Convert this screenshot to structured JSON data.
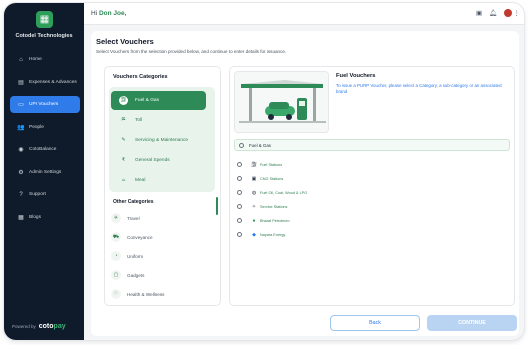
{
  "brand": {
    "name": "Cotodel Technologies",
    "logo_icon": "building-icon"
  },
  "sidebar": {
    "items": [
      {
        "label": "Home",
        "icon": "home-icon",
        "active": false
      },
      {
        "label": "Expenses & Advances",
        "icon": "receipt-icon",
        "active": false
      },
      {
        "label": "UPI Vouchers",
        "icon": "voucher-icon",
        "active": true
      },
      {
        "label": "People",
        "icon": "people-icon",
        "active": false
      },
      {
        "label": "CotoBalance",
        "icon": "wallet-icon",
        "active": false
      },
      {
        "label": "Admin Settings",
        "icon": "gear-icon",
        "active": false
      },
      {
        "label": "Support",
        "icon": "support-icon",
        "active": false
      },
      {
        "label": "Blogs",
        "icon": "blog-icon",
        "active": false
      }
    ],
    "powered_by": "Powered by",
    "powered_brand_a": "coto",
    "powered_brand_b": "pay"
  },
  "header": {
    "greeting": "Hi",
    "user_name": "Don Joe,"
  },
  "main": {
    "title": "Select Vouchers",
    "subtitle": "Select Vouchers from the selection provided below, and continue to enter details for issuance.",
    "categories_heading": "Vouchers Categories",
    "categories": [
      {
        "label": "Fuel & Gas",
        "icon": "fuel-icon",
        "active": true
      },
      {
        "label": "Toll",
        "icon": "toll-icon",
        "active": false
      },
      {
        "label": "Servicing & Maintenance",
        "icon": "wrench-icon",
        "active": false
      },
      {
        "label": "General Spends",
        "icon": "rupee-icon",
        "active": false
      },
      {
        "label": "Meal",
        "icon": "meal-icon",
        "active": false
      }
    ],
    "other_heading": "Other Categories",
    "other_categories": [
      {
        "label": "Travel",
        "icon": "travel-icon"
      },
      {
        "label": "Conveyance",
        "icon": "car-icon"
      },
      {
        "label": "Uniform",
        "icon": "shirt-icon"
      },
      {
        "label": "Gadgets",
        "icon": "gadget-icon"
      },
      {
        "label": "Health & Wellness",
        "icon": "heart-icon"
      }
    ],
    "fuel_title": "Fuel Vouchers",
    "fuel_description": "To issue a PURP Voucher, please select a Category, a sub-category or an associated brand",
    "selected_category": "Fuel & Gas",
    "sub_categories": [
      {
        "label": "Fuel Stations",
        "icon": "pump-icon"
      },
      {
        "label": "CNG Stations",
        "icon": "cng-icon"
      },
      {
        "label": "Fuel Oil, Coal, Wood & LPG",
        "icon": "flame-icon"
      },
      {
        "label": "Service Stations",
        "icon": "service-icon"
      },
      {
        "label": "Bharat Petroleum",
        "icon": "bharat-petroleum-icon"
      },
      {
        "label": "Nayara Energy",
        "icon": "nayara-icon"
      }
    ],
    "back_label": "Back",
    "continue_label": "CONTINUE"
  },
  "colors": {
    "brand_green": "#2e8b57",
    "accent_blue": "#2f7bea",
    "sidebar_bg": "#0f1b2a",
    "continue_disabled": "#b9d4f3"
  }
}
